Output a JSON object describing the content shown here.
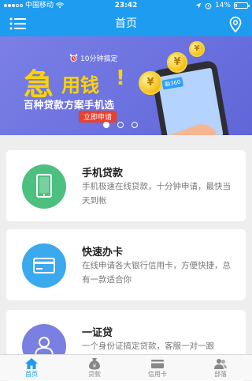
{
  "status": {
    "carrier": "中国移动",
    "time": "23:42",
    "battery": "14%",
    "battery_level": 0.14
  },
  "nav": {
    "title": "首页",
    "menu_icon": "menu-icon",
    "location_icon": "location-pin-icon"
  },
  "banner": {
    "headline_big": "急",
    "headline_rest": "用钱",
    "headline_exclaim": "!",
    "timer_text": "10分钟搞定",
    "subtitle": "百种贷款方案手机选",
    "apply_label": "立即申请",
    "phone_badge": "融360",
    "coin_symbol": "¥",
    "page_count": 3,
    "active_page": 1
  },
  "cards": [
    {
      "title": "手机贷款",
      "desc": "手机极速在线贷款，十分钟申请，最快当天到帐",
      "icon": "tablet-icon",
      "color": "#4dc07f"
    },
    {
      "title": "快速办卡",
      "desc": "在线申请各大银行信用卡，方便快捷，总有一款适合你",
      "icon": "credit-card-icon",
      "color": "#3aa9ee"
    },
    {
      "title": "一证贷",
      "desc": "一个身份证搞定贷款，客服一对一跟",
      "icon": "id-person-icon",
      "color": "#7a7fe2"
    }
  ],
  "tabs": [
    {
      "label": "首页",
      "icon": "home-icon",
      "active": true
    },
    {
      "label": "贷款",
      "icon": "money-bag-icon",
      "active": false
    },
    {
      "label": "信用卡",
      "icon": "credit-card-icon",
      "active": false
    },
    {
      "label": "部落",
      "icon": "people-icon",
      "active": false
    }
  ],
  "colors": {
    "primary": "#1d9cf0",
    "banner": "#6e74e0",
    "accent_yellow": "#fcd300",
    "apply_red": "#e8412f"
  }
}
